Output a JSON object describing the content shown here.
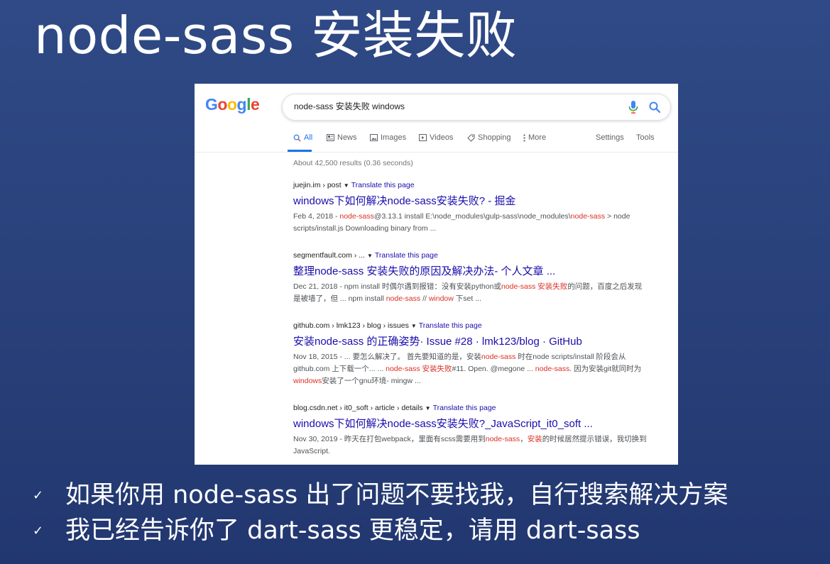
{
  "slide": {
    "title": "node-sass 安装失败",
    "bullets": [
      "如果你用 node-sass 出了问题不要找我，自行搜索解决方案",
      "我已经告诉你了 dart-sass 更稳定，请用 dart-sass"
    ],
    "bullet_glyph": "✓"
  },
  "google": {
    "logo_letters": [
      "G",
      "o",
      "o",
      "g",
      "l",
      "e"
    ],
    "logo_colors": [
      "#4285F4",
      "#EA4335",
      "#FBBC05",
      "#4285F4",
      "#34A853",
      "#EA4335"
    ],
    "query": "node-sass 安装失败 windows",
    "tabs": [
      {
        "label": "All",
        "icon": "search-icon",
        "active": true
      },
      {
        "label": "News",
        "icon": "news-icon"
      },
      {
        "label": "Images",
        "icon": "image-icon"
      },
      {
        "label": "Videos",
        "icon": "video-icon"
      },
      {
        "label": "Shopping",
        "icon": "tag-icon"
      },
      {
        "label": "More",
        "icon": "more-icon"
      }
    ],
    "settings": "Settings",
    "tools": "Tools",
    "stats": "About 42,500 results (0.36 seconds)",
    "translate": "Translate this page",
    "results": [
      {
        "crumb": "juejin.im › post",
        "title": "windows下如何解决node-sass安装失败? - 掘金",
        "snippet_segments": [
          {
            "t": "Feb 4, 2018 - "
          },
          {
            "t": "node-sass",
            "hl": true
          },
          {
            "t": "@3.13.1 install E:\\node_modules\\gulp-sass\\node_modules\\"
          },
          {
            "t": "node-sass",
            "hl": true
          },
          {
            "t": " > node scripts/install.js Downloading binary from ..."
          }
        ]
      },
      {
        "crumb": "segmentfault.com › ...",
        "title": "整理node-sass 安装失败的原因及解决办法- 个人文章 ...",
        "snippet_segments": [
          {
            "t": "Dec 21, 2018 - npm install 时偶尔遇到报错：没有安装python或"
          },
          {
            "t": "node-sass 安装失败",
            "hl": true
          },
          {
            "t": "的问题，百度之后发现是被墙了，但 ... npm install "
          },
          {
            "t": "node-sass",
            "hl": true
          },
          {
            "t": " // "
          },
          {
            "t": "window",
            "hl": true
          },
          {
            "t": " 下set ..."
          }
        ]
      },
      {
        "crumb": "github.com › lmk123 › blog › issues",
        "title": "安装node-sass 的正确姿势· Issue #28 · lmk123/blog · GitHub",
        "snippet_segments": [
          {
            "t": "Nov 18, 2015 - ... 要怎么解决了。 首先要知道的是，安装"
          },
          {
            "t": "node-sass",
            "hl": true
          },
          {
            "t": " 时在node scripts/install 阶段会从github.com 上下载一个... ... "
          },
          {
            "t": "node-sass 安装失败",
            "hl": true
          },
          {
            "t": "#11. Open. @megone ... "
          },
          {
            "t": "node-sass",
            "hl": true
          },
          {
            "t": ". 因为安装git就同时为"
          },
          {
            "t": "windows",
            "hl": true
          },
          {
            "t": "安装了一个gnu环境- mingw ..."
          }
        ]
      },
      {
        "crumb": "blog.csdn.net › it0_soft › article › details",
        "title": "windows下如何解决node-sass安装失败?_JavaScript_it0_soft ...",
        "snippet_segments": [
          {
            "t": "Nov 30, 2019 - 昨天在打包webpack，里面有scss需要用到"
          },
          {
            "t": "node-sass",
            "hl": true
          },
          {
            "t": "，"
          },
          {
            "t": "安装",
            "hl": true
          },
          {
            "t": "的时候居然提示错误，我切换到JavaScript."
          }
        ]
      }
    ]
  }
}
